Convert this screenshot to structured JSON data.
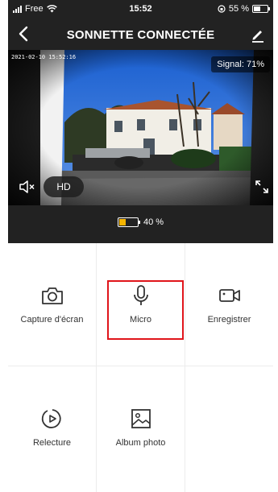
{
  "status_bar": {
    "carrier": "Free",
    "time": "15:52",
    "battery_percent": "55 %"
  },
  "header": {
    "title": "SONNETTE CONNECTÉE"
  },
  "camera": {
    "timestamp": "2021-02-10 15:52:16",
    "signal_label": "Signal: 71%",
    "quality_label": "HD"
  },
  "device_battery": {
    "label": "40 %",
    "level": 0.4,
    "color": "#f7b500"
  },
  "actions": [
    {
      "label": "Capture d'écran",
      "icon": "camera-icon"
    },
    {
      "label": "Micro",
      "icon": "microphone-icon",
      "highlighted": true
    },
    {
      "label": "Enregistrer",
      "icon": "video-camera-icon"
    },
    {
      "label": "Relecture",
      "icon": "replay-icon"
    },
    {
      "label": "Album photo",
      "icon": "photo-album-icon"
    }
  ],
  "colors": {
    "dark_bg": "#222222",
    "highlight": "#e0151b",
    "battery": "#f7b500"
  }
}
